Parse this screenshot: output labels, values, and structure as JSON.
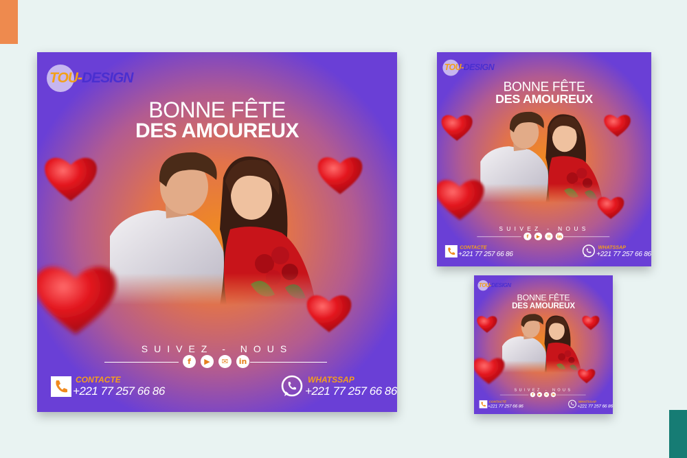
{
  "brand": {
    "logo_part1": "TOU-",
    "logo_part2": "DESIGN"
  },
  "headline": {
    "line1": "BONNE FÊTE",
    "line2": "DES AMOUREUX"
  },
  "follow": {
    "label": "SUIVEZ  -  NOUS"
  },
  "socials": [
    {
      "icon": "facebook-icon",
      "glyph": "f"
    },
    {
      "icon": "youtube-icon",
      "glyph": "▶"
    },
    {
      "icon": "email-icon",
      "glyph": "✉"
    },
    {
      "icon": "linkedin-icon",
      "glyph": "in"
    }
  ],
  "contact": {
    "label": "CONTACTE",
    "number": "+221 77 257 66 86"
  },
  "whatsapp": {
    "label": "WHATSSAP",
    "number": "+221 77 257 66 86"
  },
  "colors": {
    "background": "#e9f3f2",
    "accent_orange": "#f59e1c",
    "accent_purple": "#6a3fd6",
    "heart_red": "#e11a22",
    "corner_orange": "#ee8a4e",
    "corner_teal": "#167c74"
  }
}
